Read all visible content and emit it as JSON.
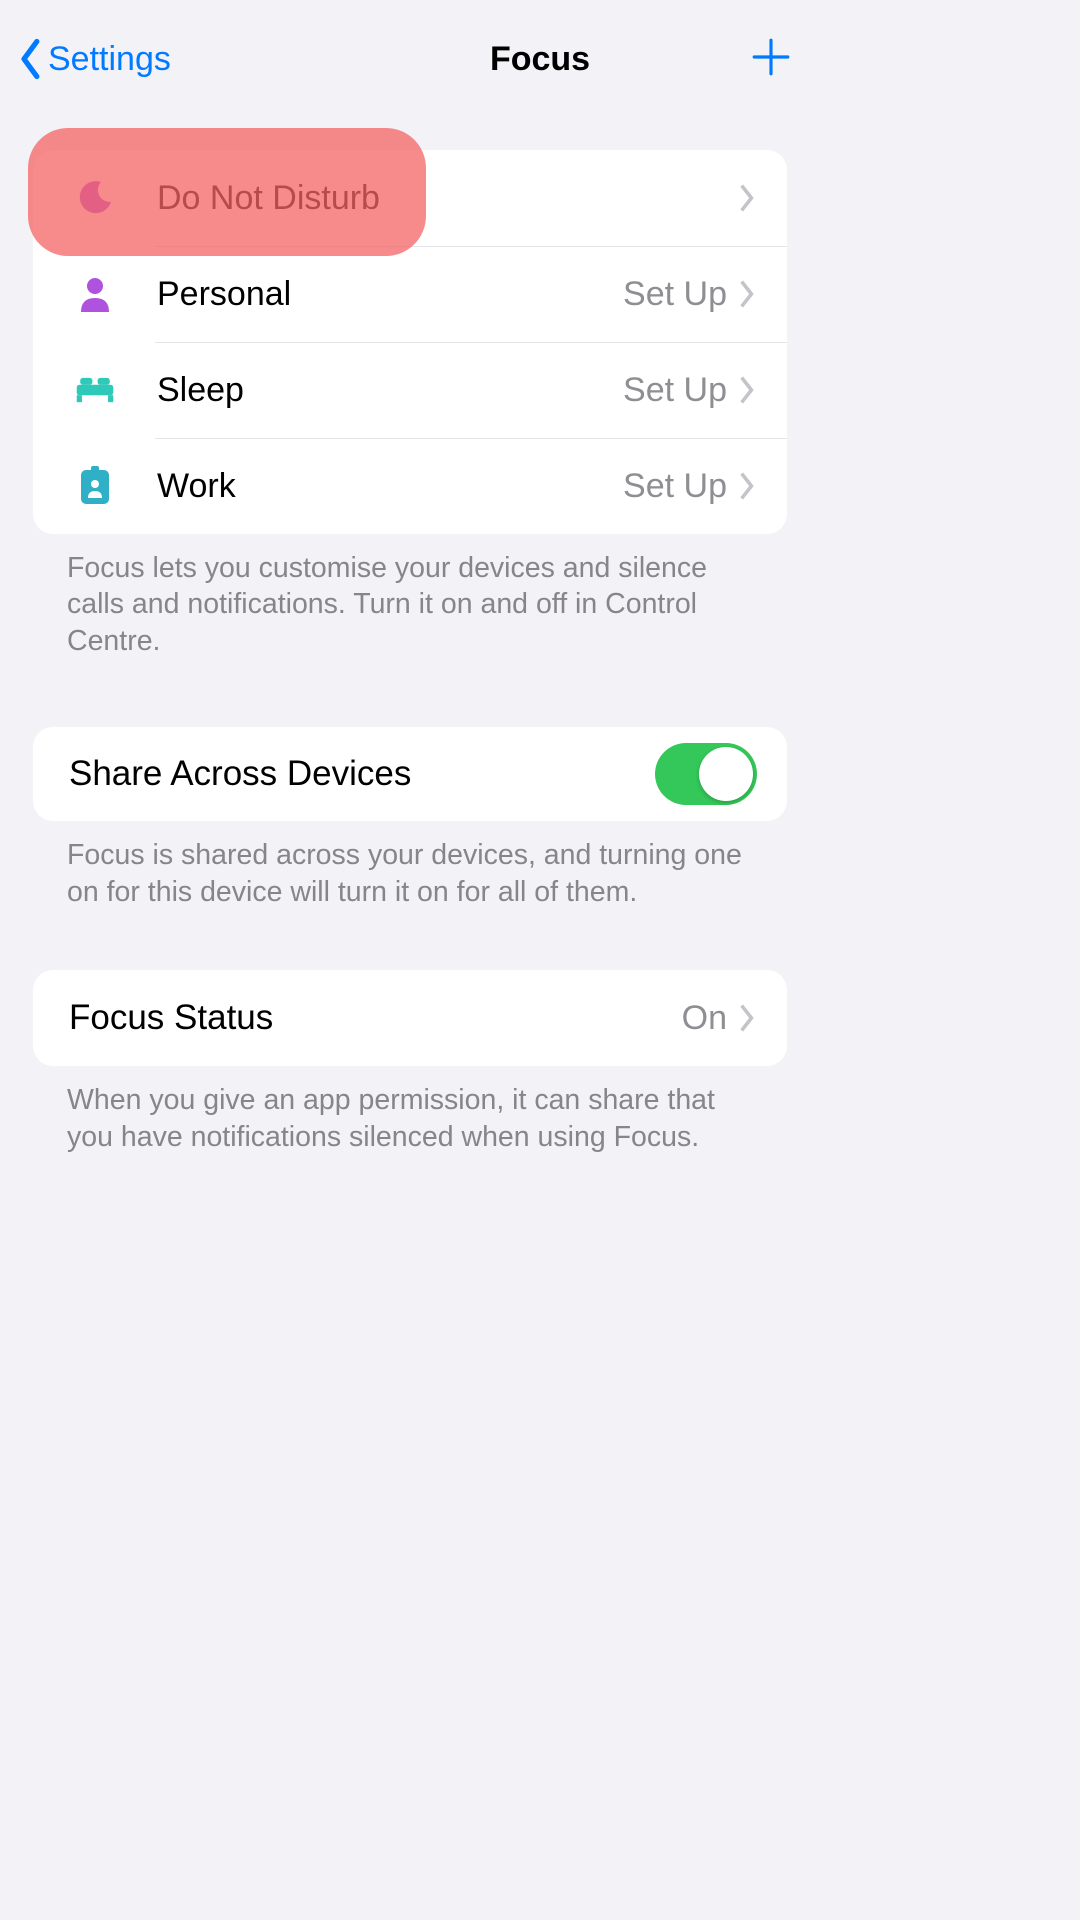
{
  "nav": {
    "back": "Settings",
    "title": "Focus"
  },
  "focus_modes": [
    {
      "icon": "moon-icon",
      "label": "Do Not Disturb",
      "trailing": "",
      "color": "#af52de"
    },
    {
      "icon": "person-icon",
      "label": "Personal",
      "trailing": "Set Up",
      "color": "#af52de"
    },
    {
      "icon": "bed-icon",
      "label": "Sleep",
      "trailing": "Set Up",
      "color": "#30d5c8"
    },
    {
      "icon": "badge-icon",
      "label": "Work",
      "trailing": "Set Up",
      "color": "#30b0c7"
    }
  ],
  "captions": {
    "modes": "Focus lets you customise your devices and silence calls and notifications. Turn it on and off in Control Centre.",
    "share": "Focus is shared across your devices, and turning one on for this device will turn it on for all of them.",
    "status": "When you give an app permission, it can share that you have notifications silenced when using Focus."
  },
  "share": {
    "label": "Share Across Devices",
    "on": true
  },
  "status": {
    "label": "Focus Status",
    "value": "On"
  }
}
